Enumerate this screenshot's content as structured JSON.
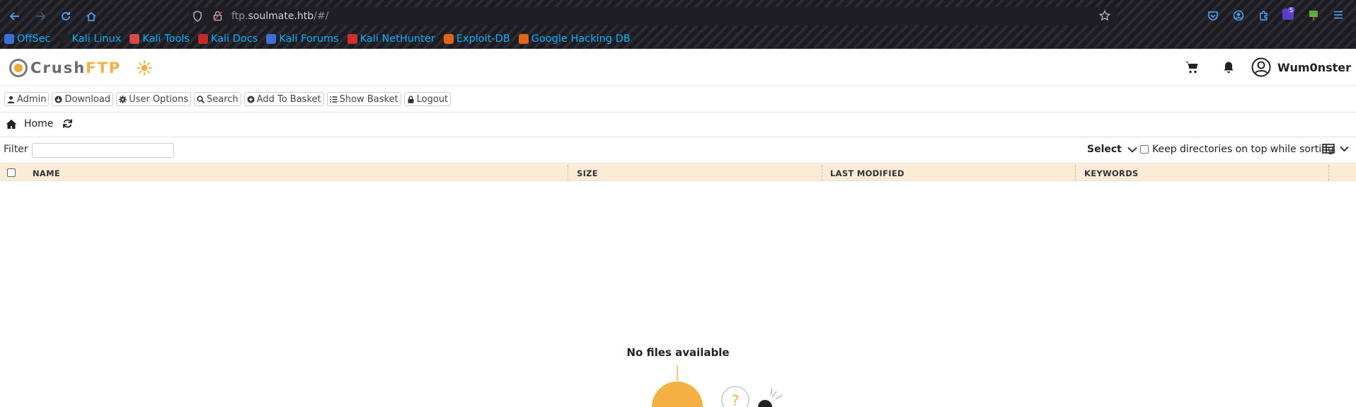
{
  "browser": {
    "url_prefix": "ftp.",
    "url_host": "soulmate.htb",
    "url_suffix": "/#/",
    "extension_badge": "5",
    "bookmarks": [
      {
        "label": "OffSec",
        "color": "#3b6fd8"
      },
      {
        "label": "Kali Linux",
        "color": "#222222"
      },
      {
        "label": "Kali Tools",
        "color": "#d94848"
      },
      {
        "label": "Kali Docs",
        "color": "#c62828"
      },
      {
        "label": "Kali Forums",
        "color": "#3d6fd8"
      },
      {
        "label": "Kali NetHunter",
        "color": "#d32f2f"
      },
      {
        "label": "Exploit-DB",
        "color": "#e0641a"
      },
      {
        "label": "Google Hacking DB",
        "color": "#e0641a"
      }
    ]
  },
  "header": {
    "logo_crush": "Crush",
    "logo_ftp": "FTP",
    "username": "Wum0nster"
  },
  "toolbar": {
    "buttons": [
      {
        "label": "Admin",
        "icon": "user-icon"
      },
      {
        "label": "Download",
        "icon": "download-icon"
      },
      {
        "label": "User Options",
        "icon": "gear-icon"
      },
      {
        "label": "Search",
        "icon": "search-icon"
      },
      {
        "label": "Add To Basket",
        "icon": "plus-circle-icon"
      },
      {
        "label": "Show Basket",
        "icon": "list-icon"
      },
      {
        "label": "Logout",
        "icon": "lock-icon"
      }
    ]
  },
  "breadcrumb": {
    "home_label": "Home"
  },
  "filter": {
    "label": "Filter",
    "value": ""
  },
  "options": {
    "select_label": "Select",
    "keep_dirs_label": "Keep directories on top while sorting"
  },
  "table": {
    "columns": [
      "NAME",
      "SIZE",
      "LAST MODIFIED",
      "KEYWORDS"
    ]
  },
  "empty_state": {
    "message": "No files available"
  },
  "colors": {
    "accent": "#f4b042",
    "table_header_bg": "#fbecd8",
    "link": "#00b2ff"
  }
}
